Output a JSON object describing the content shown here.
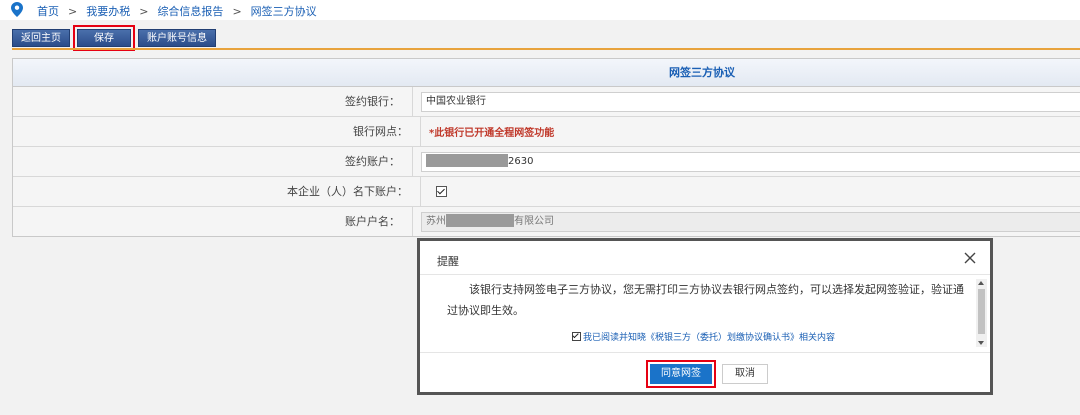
{
  "breadcrumb": {
    "items": [
      "首页",
      "我要办税",
      "综合信息报告",
      "网签三方协议"
    ],
    "separator": ">"
  },
  "toolbar": {
    "back_label": "返回主页",
    "save_label": "保存",
    "account_label": "账户账号信息"
  },
  "form": {
    "title": "网签三方协议",
    "rows": [
      {
        "label": "签约银行：",
        "value": "中国农业银行"
      },
      {
        "label": "银行网点：",
        "value": "*此银行已开通全程网签功能"
      },
      {
        "label": "签约账户：",
        "value_suffix": "2630"
      },
      {
        "label": "本企业（人）名下账户：",
        "checked": true
      },
      {
        "label": "账户户名：",
        "value_prefix": "苏州",
        "value_suffix": "有限公司"
      }
    ]
  },
  "dialog": {
    "title": "提醒",
    "message": "该银行支持网签电子三方协议，您无需打印三方协议去银行网点签约，可以选择发起网签验证，验证通过协议即生效。",
    "agree_text": "我已阅读并知晓《税银三方（委托）划缴协议确认书》相关内容",
    "agree_button": "同意网签",
    "cancel_button": "取消"
  },
  "colors": {
    "link": "#1a5fb4",
    "toolbar_button": "#2b4d8a",
    "accent_line": "#e8a33d",
    "highlight": "#e60012",
    "primary_button": "#1a73c9",
    "hint_red": "#c0392b"
  }
}
